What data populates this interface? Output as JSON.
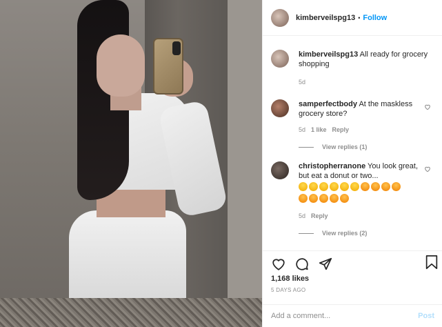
{
  "post": {
    "author": "kimberveilspg13",
    "separator": "•",
    "follow_label": "Follow"
  },
  "caption": {
    "author": "kimberveilspg13",
    "text": "All ready for grocery shopping",
    "age": "5d"
  },
  "comments": [
    {
      "author": "samperfectbody",
      "text": "At the maskless grocery store?",
      "age": "5d",
      "likes": "1 like",
      "reply_label": "Reply",
      "view_replies": "View replies (1)"
    },
    {
      "author": "christopherranone",
      "text": "You look great, but eat a donut or two...",
      "emoji_row1": [
        "grin",
        "grin",
        "grin",
        "grin",
        "grin",
        "grin",
        "eyes",
        "eyes",
        "eyes",
        "eyes"
      ],
      "emoji_row2": [
        "eyes",
        "eyes",
        "eyes",
        "eyes",
        "eyes"
      ],
      "age": "5d",
      "reply_label": "Reply",
      "view_replies": "View replies (2)"
    }
  ],
  "actions": {
    "icons": [
      "heart-icon",
      "comment-icon",
      "share-icon",
      "bookmark-icon"
    ],
    "likes": "1,168 likes",
    "time": "5 DAYS AGO"
  },
  "add_comment": {
    "placeholder": "Add a comment...",
    "post_label": "Post"
  },
  "colors": {
    "link": "#0095f6",
    "post_disabled": "#b2dffc",
    "muted": "#8e8e8e"
  }
}
